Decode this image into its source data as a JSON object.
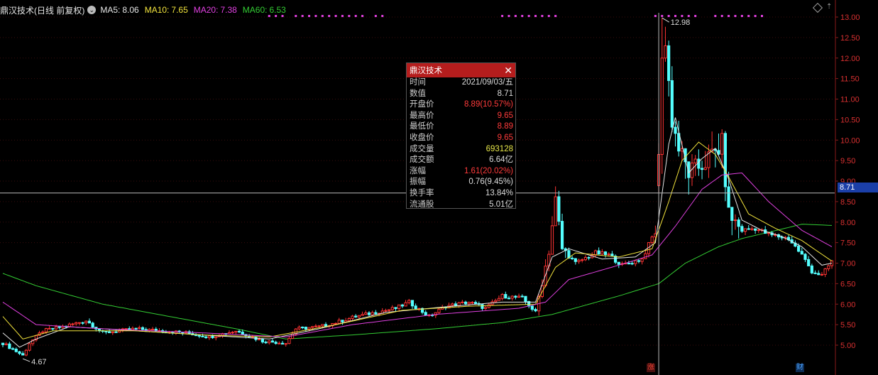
{
  "legend": {
    "name": "鼎汉技术(日线 前复权)",
    "dropdown_glyph": "⌄",
    "ma": [
      {
        "label": "MA5:",
        "value": "8.06",
        "color": "#e6e6e6"
      },
      {
        "label": "MA10:",
        "value": "7.65",
        "color": "#f2e33c"
      },
      {
        "label": "MA20:",
        "value": "7.38",
        "color": "#e040e0"
      },
      {
        "label": "MA60:",
        "value": "6.53",
        "color": "#33cc33"
      }
    ]
  },
  "crosshair": {
    "price_label": "8.71",
    "value": 8.71,
    "x_index": 197
  },
  "popup": {
    "title": "鼎汉技术",
    "close_glyph": "✕",
    "rows": [
      {
        "label": "时间",
        "value": "2021/09/03/五",
        "color": "#dddddd"
      },
      {
        "label": "数值",
        "value": "8.71",
        "color": "#dddddd"
      },
      {
        "label": "开盘价",
        "value": "8.89(10.57%)",
        "color": "#ff3b3b"
      },
      {
        "label": "最高价",
        "value": "9.65",
        "color": "#ff3b3b"
      },
      {
        "label": "最低价",
        "value": "8.89",
        "color": "#ff3b3b"
      },
      {
        "label": "收盘价",
        "value": "9.65",
        "color": "#ff3b3b"
      },
      {
        "label": "成交量",
        "value": "693128",
        "color": "#e8e84a"
      },
      {
        "label": "成交额",
        "value": "6.64亿",
        "color": "#dddddd"
      },
      {
        "label": "涨幅",
        "value": "1.61(20.02%)",
        "color": "#ff3b3b"
      },
      {
        "label": "振幅",
        "value": "0.76(9.45%)",
        "color": "#dddddd"
      },
      {
        "label": "换手率",
        "value": "13.84%",
        "color": "#dddddd"
      },
      {
        "label": "流通股",
        "value": "5.01亿",
        "color": "#dddddd"
      }
    ]
  },
  "markers": {
    "zhang": "涨",
    "cai": "财"
  },
  "chart_data": {
    "type": "candlestick",
    "ylim": [
      4.6,
      13.2
    ],
    "y_ticks": [
      "13.00",
      "12.50",
      "12.00",
      "11.50",
      "11.00",
      "10.50",
      "10.00",
      "9.50",
      "9.00",
      "8.50",
      "8.00",
      "7.50",
      "7.00",
      "6.50",
      "6.00",
      "5.50",
      "5.00"
    ],
    "annotations": [
      {
        "text": "4.67",
        "index": 6,
        "value": 4.67
      },
      {
        "text": "12.98",
        "index": 198,
        "value": 12.98
      }
    ],
    "colors": {
      "up": "#ff3333",
      "down": "#54ffff",
      "ma60": "#33cc33"
    },
    "price_path": [
      [
        0,
        5.05
      ],
      [
        6,
        4.75
      ],
      [
        8,
        5.05
      ],
      [
        12,
        5.35
      ],
      [
        18,
        5.45
      ],
      [
        25,
        5.6
      ],
      [
        30,
        5.3
      ],
      [
        40,
        5.4
      ],
      [
        55,
        5.3
      ],
      [
        62,
        5.2
      ],
      [
        70,
        5.35
      ],
      [
        78,
        5.1
      ],
      [
        85,
        5.05
      ],
      [
        88,
        5.4
      ],
      [
        95,
        5.45
      ],
      [
        100,
        5.55
      ],
      [
        106,
        5.7
      ],
      [
        112,
        5.8
      ],
      [
        118,
        5.9
      ],
      [
        122,
        6.05
      ],
      [
        128,
        5.7
      ],
      [
        133,
        5.95
      ],
      [
        140,
        6.05
      ],
      [
        145,
        5.9
      ],
      [
        150,
        6.2
      ],
      [
        156,
        6.15
      ],
      [
        160,
        5.8
      ],
      [
        164,
        7.3
      ],
      [
        166,
        8.55
      ],
      [
        168,
        7.35
      ],
      [
        172,
        7.0
      ],
      [
        178,
        7.25
      ],
      [
        182,
        7.2
      ],
      [
        186,
        6.95
      ],
      [
        192,
        7.1
      ],
      [
        196,
        7.8
      ],
      [
        197,
        9.65
      ],
      [
        199,
        12.3
      ],
      [
        201,
        10.5
      ],
      [
        203,
        9.8
      ],
      [
        206,
        9.2
      ],
      [
        210,
        9.4
      ],
      [
        214,
        9.7
      ],
      [
        216,
        9.9
      ],
      [
        218,
        8.2
      ],
      [
        222,
        7.8
      ],
      [
        226,
        7.85
      ],
      [
        230,
        7.7
      ],
      [
        236,
        7.6
      ],
      [
        240,
        7.2
      ],
      [
        243,
        6.8
      ],
      [
        246,
        6.7
      ],
      [
        249,
        7.05
      ]
    ],
    "ma_paths": {
      "MA5": [
        [
          0,
          5.3
        ],
        [
          5,
          4.95
        ],
        [
          10,
          5.15
        ],
        [
          20,
          5.45
        ],
        [
          40,
          5.35
        ],
        [
          60,
          5.25
        ],
        [
          80,
          5.15
        ],
        [
          95,
          5.4
        ],
        [
          115,
          5.8
        ],
        [
          135,
          5.95
        ],
        [
          150,
          6.05
        ],
        [
          160,
          6.05
        ],
        [
          165,
          7.15
        ],
        [
          170,
          7.35
        ],
        [
          180,
          7.1
        ],
        [
          190,
          7.15
        ],
        [
          196,
          7.5
        ],
        [
          200,
          9.9
        ],
        [
          202,
          10.55
        ],
        [
          206,
          9.2
        ],
        [
          210,
          9.55
        ],
        [
          214,
          9.8
        ],
        [
          218,
          9.05
        ],
        [
          222,
          8.05
        ],
        [
          228,
          7.8
        ],
        [
          234,
          7.65
        ],
        [
          240,
          7.4
        ],
        [
          246,
          6.95
        ],
        [
          249,
          7.0
        ]
      ],
      "MA10": [
        [
          0,
          5.7
        ],
        [
          6,
          5.15
        ],
        [
          15,
          5.35
        ],
        [
          40,
          5.35
        ],
        [
          60,
          5.25
        ],
        [
          80,
          5.2
        ],
        [
          100,
          5.5
        ],
        [
          120,
          5.85
        ],
        [
          140,
          5.95
        ],
        [
          160,
          6.0
        ],
        [
          166,
          6.9
        ],
        [
          172,
          7.25
        ],
        [
          185,
          7.15
        ],
        [
          195,
          7.35
        ],
        [
          200,
          8.5
        ],
        [
          204,
          9.5
        ],
        [
          209,
          9.95
        ],
        [
          214,
          9.65
        ],
        [
          218,
          9.1
        ],
        [
          224,
          8.2
        ],
        [
          232,
          7.85
        ],
        [
          240,
          7.55
        ],
        [
          249,
          7.05
        ]
      ],
      "MA20": [
        [
          0,
          6.05
        ],
        [
          10,
          5.5
        ],
        [
          30,
          5.4
        ],
        [
          60,
          5.3
        ],
        [
          85,
          5.2
        ],
        [
          105,
          5.5
        ],
        [
          130,
          5.75
        ],
        [
          155,
          5.9
        ],
        [
          163,
          6.05
        ],
        [
          170,
          6.6
        ],
        [
          185,
          6.95
        ],
        [
          195,
          7.2
        ],
        [
          202,
          7.9
        ],
        [
          210,
          8.8
        ],
        [
          216,
          9.15
        ],
        [
          222,
          9.2
        ],
        [
          230,
          8.5
        ],
        [
          240,
          7.8
        ],
        [
          249,
          7.4
        ]
      ],
      "MA60": [
        [
          0,
          6.75
        ],
        [
          10,
          6.45
        ],
        [
          30,
          6.0
        ],
        [
          50,
          5.7
        ],
        [
          70,
          5.4
        ],
        [
          85,
          5.15
        ],
        [
          105,
          5.25
        ],
        [
          130,
          5.4
        ],
        [
          150,
          5.55
        ],
        [
          165,
          5.75
        ],
        [
          185,
          6.2
        ],
        [
          197,
          6.5
        ],
        [
          205,
          7.0
        ],
        [
          215,
          7.4
        ],
        [
          222,
          7.6
        ],
        [
          235,
          7.85
        ],
        [
          240,
          7.95
        ],
        [
          249,
          7.92
        ]
      ]
    },
    "pattern_dots": [
      [
        80,
        84
      ],
      [
        88,
        98
      ],
      [
        100,
        108
      ],
      [
        112,
        114
      ],
      [
        150,
        166
      ],
      [
        196,
        208
      ],
      [
        214,
        228
      ]
    ]
  }
}
